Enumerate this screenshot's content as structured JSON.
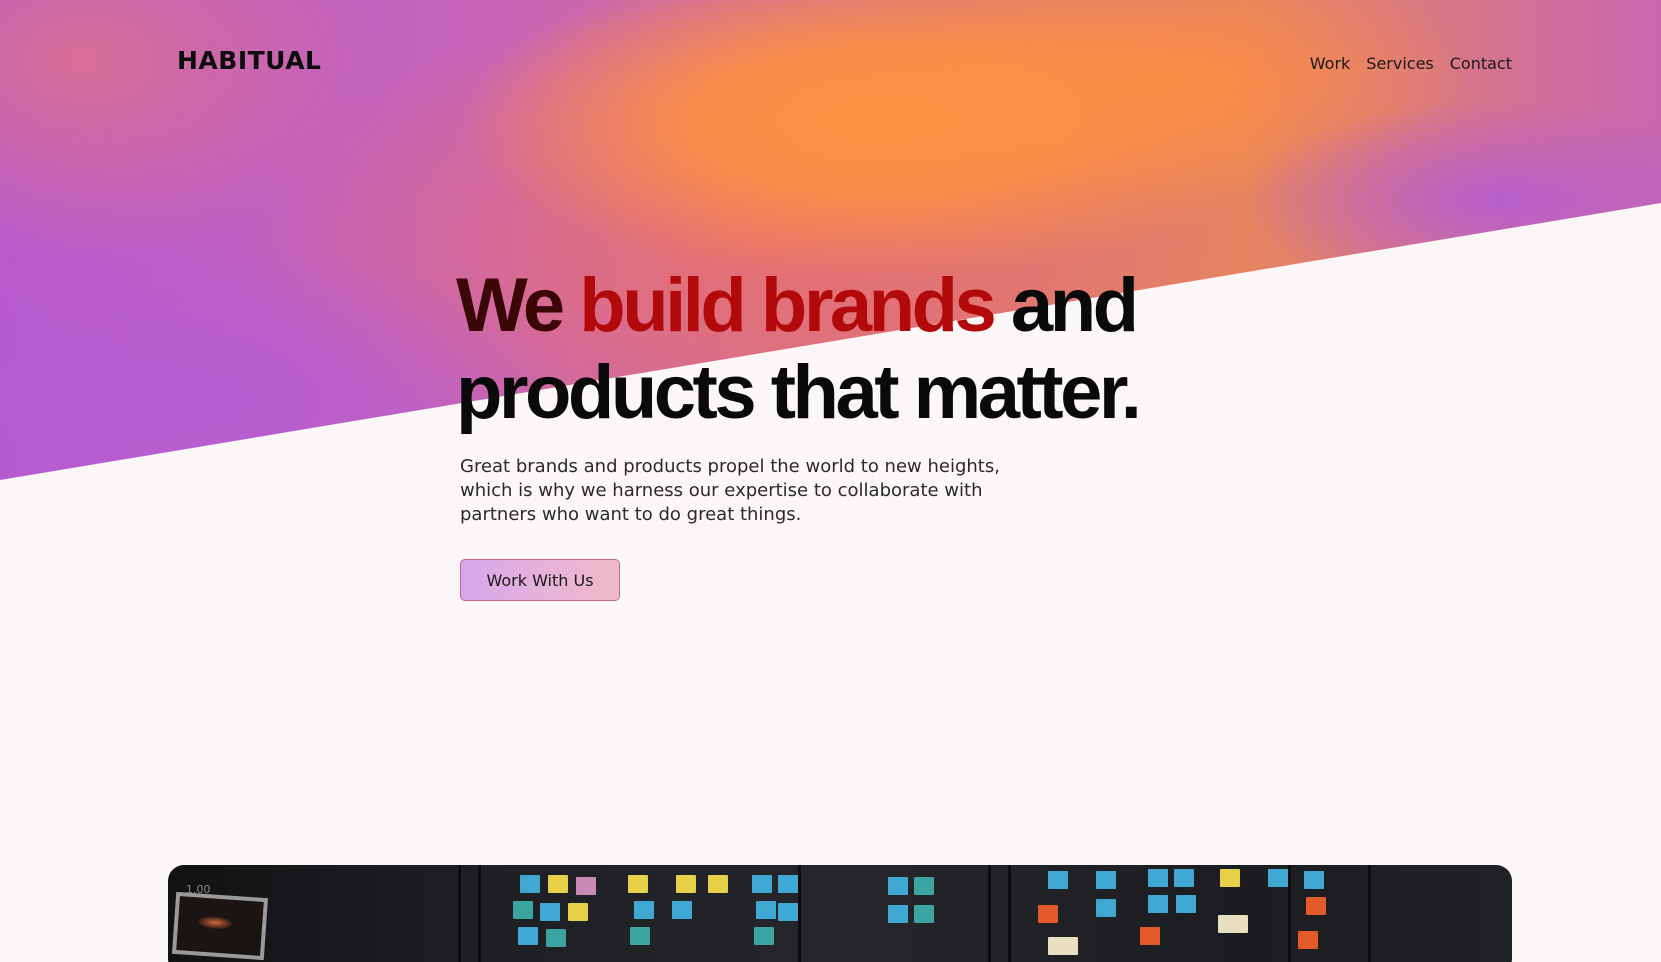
{
  "header": {
    "logo": "HABITUAL",
    "nav": [
      "Work",
      "Services",
      "Contact"
    ]
  },
  "hero": {
    "headline_line1": [
      "We",
      "build",
      "brands",
      "and"
    ],
    "headline_line2": "products that matter.",
    "subtext": "Great brands and products propel the world to new heights, which is why we harness our expertise to collaborate with partners who want to do great things.",
    "cta_label": "Work With Us"
  },
  "media": {
    "timer": "1.00"
  },
  "colors": {
    "accent_orange": "#ff9242",
    "accent_purple": "#b75bcd",
    "headline_red": "#b20a0a",
    "background": "#fcf7f7"
  }
}
